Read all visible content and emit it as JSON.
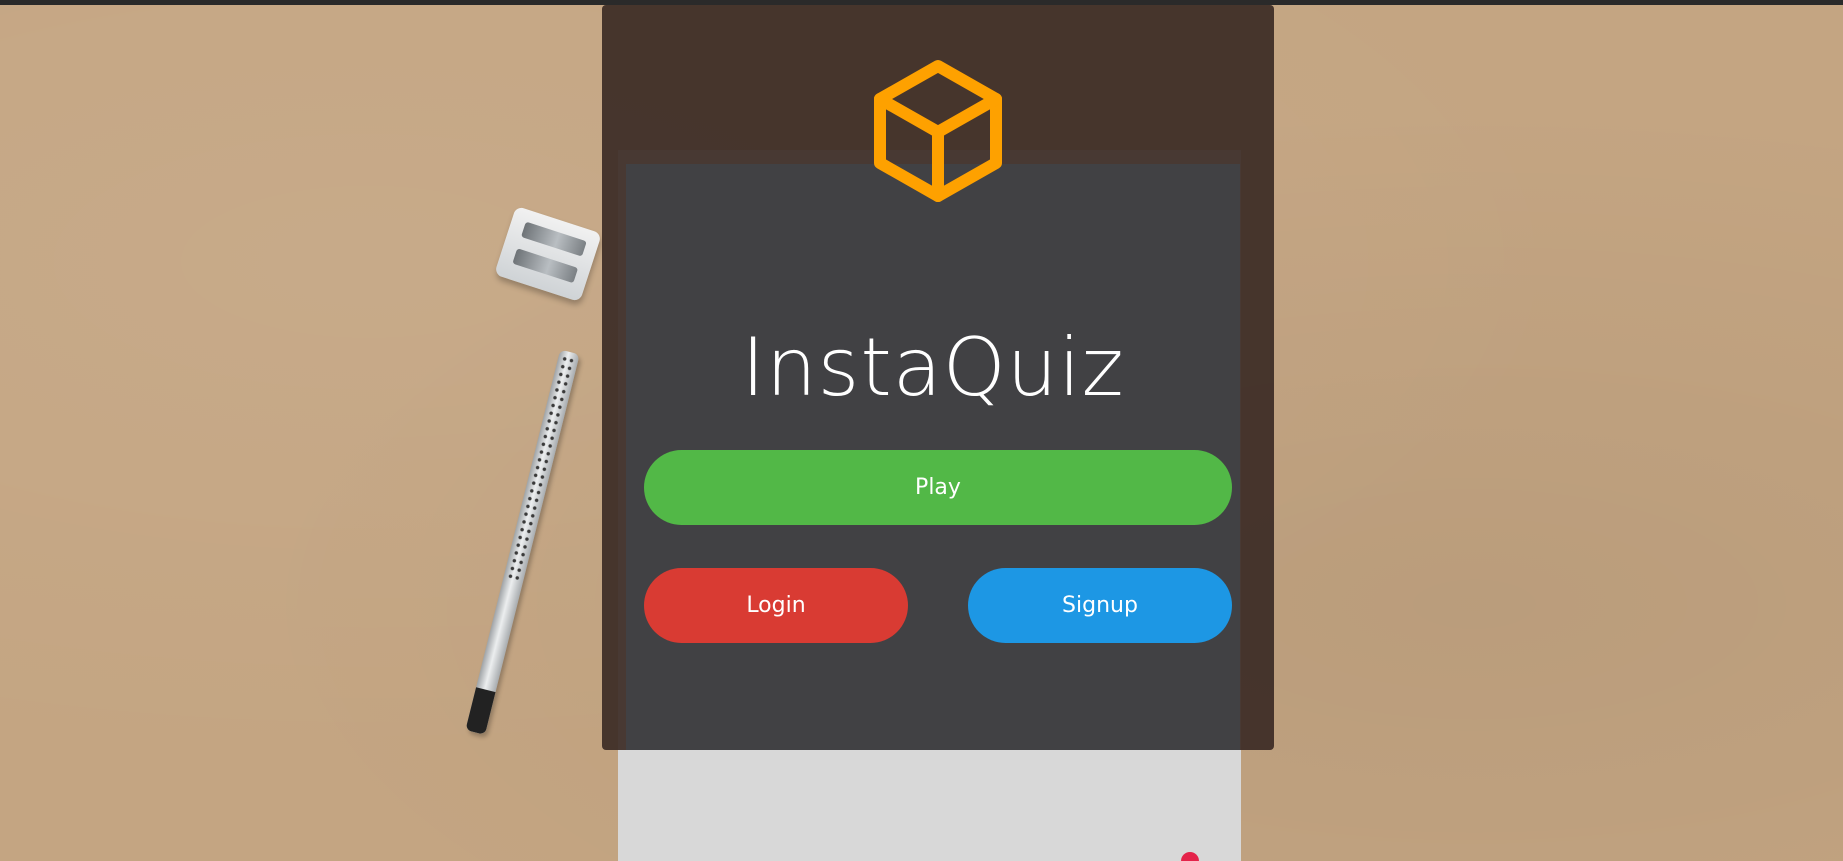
{
  "app": {
    "title": "InstaQuiz",
    "logo_icon": "cube-icon",
    "accent_color": "#fea100"
  },
  "buttons": {
    "play_label": "Play",
    "login_label": "Login",
    "signup_label": "Signup"
  },
  "colors": {
    "play": "#52b847",
    "login": "#d93b33",
    "signup": "#1d97e4",
    "card": "#414144",
    "background": "#c4a582"
  }
}
